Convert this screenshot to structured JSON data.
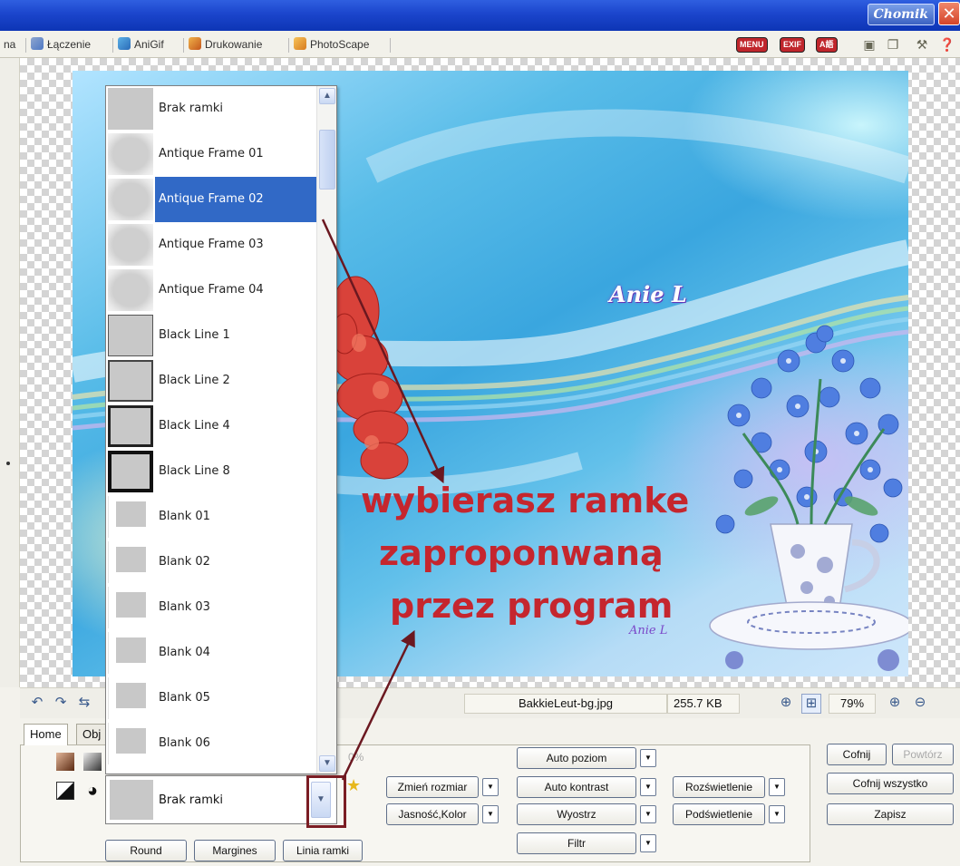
{
  "window": {
    "brand": "Chomik",
    "close_glyph": "✕",
    "accent_colors": {
      "titlebar": "#1b45cc",
      "selection": "#3169c6",
      "annotation": "#c5262e"
    }
  },
  "tabs": [
    {
      "label": "na",
      "icon": "partial-tab"
    },
    {
      "label": "Łączenie",
      "icon": "combine-icon"
    },
    {
      "label": "AniGif",
      "icon": "anigif-icon"
    },
    {
      "label": "Drukowanie",
      "icon": "print-icon"
    },
    {
      "label": "PhotoScape",
      "icon": "photoscape-icon"
    }
  ],
  "toolbar_right": {
    "menu_label": "MENU",
    "exif_label": "EXIF",
    "lang_label": "A語"
  },
  "photo": {
    "watermark_top": "Anie L",
    "watermark_bottom": "Anie L"
  },
  "annotation": {
    "line1": "wybierasz ramke",
    "line2": "zaproponwaną",
    "line3": "przez program"
  },
  "frame_list": {
    "items": [
      {
        "label": "Brak ramki",
        "style": "none"
      },
      {
        "label": "Antique Frame 01",
        "style": "antique"
      },
      {
        "label": "Antique Frame 02",
        "style": "antique",
        "selected": true
      },
      {
        "label": "Antique Frame 03",
        "style": "antique"
      },
      {
        "label": "Antique Frame 04",
        "style": "antique"
      },
      {
        "label": "Black Line 1",
        "style": "line1"
      },
      {
        "label": "Black Line 2",
        "style": "line2"
      },
      {
        "label": "Black Line 4",
        "style": "line4"
      },
      {
        "label": "Black Line 8",
        "style": "line8"
      },
      {
        "label": "Blank 01",
        "style": "blank"
      },
      {
        "label": "Blank 02",
        "style": "blank"
      },
      {
        "label": "Blank 03",
        "style": "blank"
      },
      {
        "label": "Blank 04",
        "style": "blank"
      },
      {
        "label": "Blank 05",
        "style": "blank"
      },
      {
        "label": "Blank 06",
        "style": "blank"
      }
    ],
    "scroll_position": 0.04
  },
  "frame_combo": {
    "value": "Brak ramki"
  },
  "status": {
    "filename": "BakkieLeut-bg.jpg",
    "filesize": "255.7 KB",
    "zoom": "79%"
  },
  "panel": {
    "tab_home": "Home",
    "tab_object": "Obj",
    "partial_percent": "0%",
    "round_btn": "Round",
    "margins_btn": "Margines",
    "frame_line_btn": "Linia ramki",
    "resize_btn": "Zmień rozmiar",
    "brightness_btn": "Jasność,Kolor",
    "auto_level_btn": "Auto poziom",
    "auto_contrast_btn": "Auto kontrast",
    "sharpen_btn": "Wyostrz",
    "filter_btn": "Filtr",
    "brighten_btn": "Rozświetlenie",
    "backlight_btn": "Podświetlenie",
    "undo_btn": "Cofnij",
    "redo_btn": "Powtórz",
    "undo_all_btn": "Cofnij wszystko",
    "save_btn": "Zapisz"
  }
}
